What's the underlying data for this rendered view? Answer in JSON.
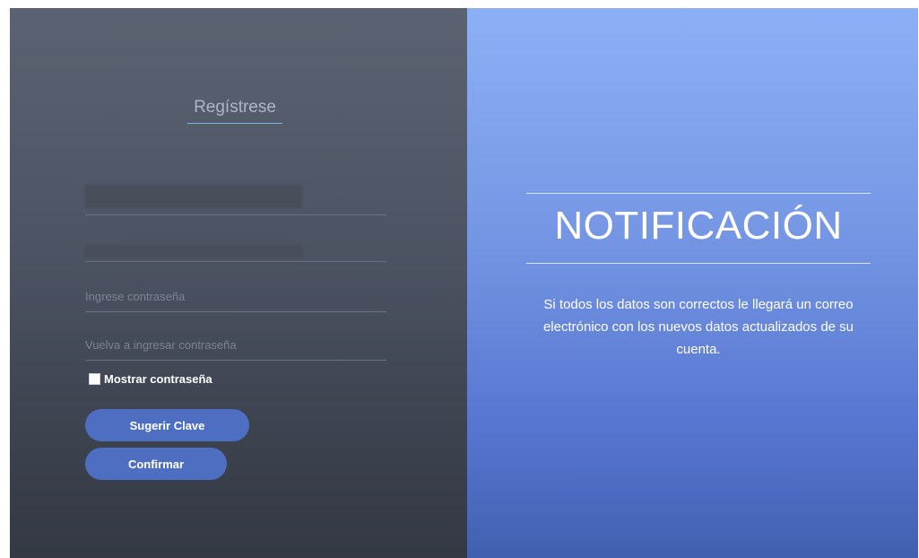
{
  "form": {
    "title": "Regístrese",
    "fields": {
      "field1_value": "",
      "field2_hint": "········",
      "password_placeholder": "Ingrese contraseña",
      "confirm_password_placeholder": "Vuelva a ingresar contraseña"
    },
    "show_password_label": "Mostrar contraseña",
    "suggest_button_label": "Sugerir Clave",
    "confirm_button_label": "Confirmar"
  },
  "notification": {
    "title": "NOTIFICACIÓN",
    "message": "Si todos los datos son correctos le llegará un correo electrónico con los nuevos datos actualizados de su cuenta."
  },
  "colors": {
    "button_bg": "#4e6ec2",
    "title_underline": "#7faee8",
    "right_panel_top": "#8cb0f6",
    "right_panel_bottom": "#4260b0"
  }
}
